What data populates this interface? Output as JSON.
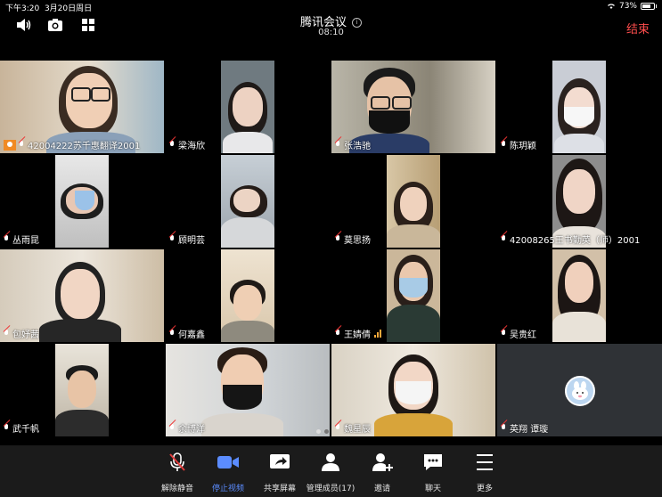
{
  "status_bar": {
    "time": "下午3:20",
    "date": "3月20日周日",
    "battery": "73%",
    "battery_level": 0.73
  },
  "header": {
    "title": "腾讯会议",
    "timer": "08:10",
    "end_label": "结束",
    "icons": [
      "speaker-icon",
      "camera-switch-icon",
      "grid-view-icon"
    ]
  },
  "participants": [
    {
      "name": "42004222苏千惠翻译2001",
      "host": true
    },
    {
      "name": "梁海欣"
    },
    {
      "name": "张浩驰"
    },
    {
      "name": "陈玥颖"
    },
    {
      "name": "丛雨昆"
    },
    {
      "name": "顾明芸"
    },
    {
      "name": "莫思扬"
    },
    {
      "name": "42008265王书勤英（师）2001"
    },
    {
      "name": "包妤茜"
    },
    {
      "name": "何嘉鑫"
    },
    {
      "name": "王婧倩",
      "speaking": true
    },
    {
      "name": "吴贵红"
    },
    {
      "name": "武千帆"
    },
    {
      "name": "余博洋"
    },
    {
      "name": "魏星辰"
    },
    {
      "name": "英翔 谭璇"
    }
  ],
  "toolbar": [
    {
      "label": "解除静音",
      "icon": "unmute-mic-icon"
    },
    {
      "label": "停止视频",
      "icon": "video-camera-icon",
      "active": true
    },
    {
      "label": "共享屏幕",
      "icon": "share-screen-icon"
    },
    {
      "label": "管理成员(17)",
      "icon": "members-icon"
    },
    {
      "label": "邀请",
      "icon": "invite-icon"
    },
    {
      "label": "聊天",
      "icon": "chat-icon"
    },
    {
      "label": "更多",
      "icon": "more-icon"
    }
  ],
  "colors": {
    "end": "#ff4d4d",
    "accent": "#5b8cff",
    "host_badge": "#f08a24"
  }
}
